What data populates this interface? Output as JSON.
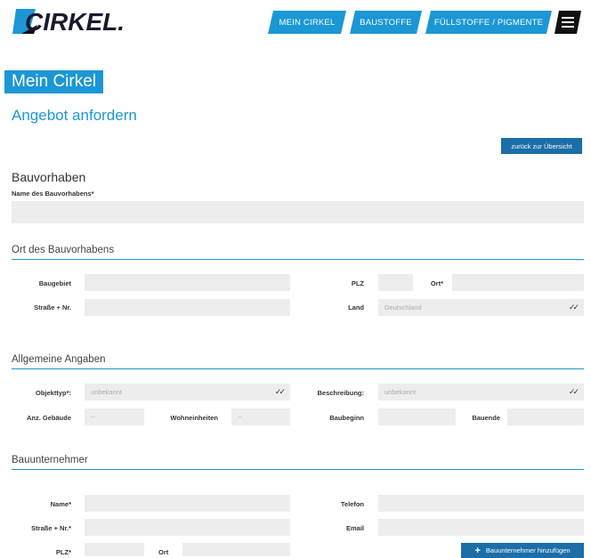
{
  "logo": {
    "text": "CIRKEL."
  },
  "nav": {
    "tabs": [
      {
        "label": "MEIN CIRKEL"
      },
      {
        "label": "BAUSTOFFE"
      },
      {
        "label": "FÜLLSTOFFE / PIGMENTE"
      }
    ]
  },
  "colors": {
    "accent": "#1b97d5",
    "button_dark": "#1b6ea8",
    "field_bg": "#ededed"
  },
  "page": {
    "title": "Mein Cirkel",
    "subtitle": "Angebot anfordern",
    "back_label": "zurück zur Übersicht"
  },
  "bauvorhaben": {
    "heading": "Bauvorhaben",
    "name_label": "Name des Bauvorhabens*"
  },
  "ort": {
    "heading": "Ort des Bauvorhabens",
    "baugebiet_label": "Baugebiet",
    "plz_label": "PLZ",
    "ort_label": "Ort*",
    "strasse_label": "Straße + Nr.",
    "land_label": "Land",
    "land_value": "Deutschland"
  },
  "allgemein": {
    "heading": "Allgemeine Angaben",
    "objekttyp_label": "Objekttyp*:",
    "objekttyp_value": "unbekannt",
    "beschreibung_label": "Beschreibung:",
    "beschreibung_value": "unbekannt",
    "gebaeude_label": "Anz. Gebäude",
    "gebaeude_value": "--",
    "wohneinheiten_label": "Wohneinheiten",
    "wohneinheiten_value": "--",
    "baubeginn_label": "Baubeginn",
    "bauende_label": "Bauende"
  },
  "unternehmer": {
    "heading": "Bauunternehmer",
    "name_label": "Name*",
    "telefon_label": "Telefon",
    "strasse_label": "Straße + Nr.*",
    "email_label": "Email",
    "plz_label": "PLZ*",
    "ort_label": "Ort",
    "add_label": "Bauunternehmer hinzufügen"
  }
}
